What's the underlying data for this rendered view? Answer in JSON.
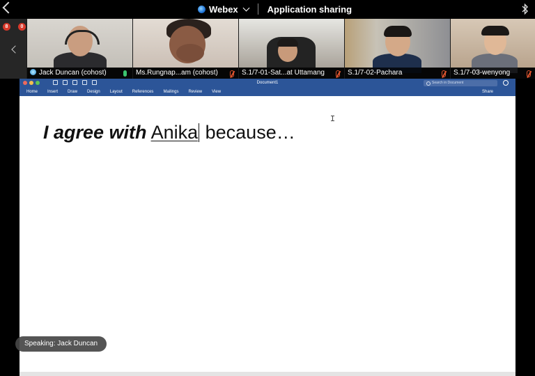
{
  "topbar": {
    "app_name": "Webex",
    "title": "Application sharing"
  },
  "participants": [
    {
      "name": "Jack Duncan (cohost)",
      "mic": "on",
      "cohost_badge": true
    },
    {
      "name": "Ms.Rungnap...am (cohost)",
      "mic": "muted",
      "cohost_badge": false
    },
    {
      "name": "S.1/7-01-Sat...at Uttamang",
      "mic": "muted",
      "cohost_badge": false
    },
    {
      "name": "S.1/7-02-Pachara",
      "mic": "muted",
      "cohost_badge": false
    },
    {
      "name": "S.1/7-03-wenyong",
      "mic": "muted",
      "cohost_badge": false
    }
  ],
  "word": {
    "doc_title": "Document1",
    "search_placeholder": "Search in Document",
    "share_label": "Share",
    "ribbon_tabs": [
      "Home",
      "Insert",
      "Draw",
      "Design",
      "Layout",
      "References",
      "Mailings",
      "Review",
      "View"
    ],
    "document": {
      "bold_italic": "I agree with",
      "underlined": "Anika",
      "rest": "because…"
    }
  },
  "speaking": "Speaking: Jack Duncan",
  "colors": {
    "ribbon": "#2c5598",
    "mic_muted": "#e0552f",
    "mic_on": "#3bc46e"
  }
}
